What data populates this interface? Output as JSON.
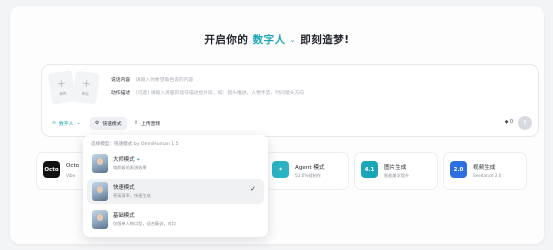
{
  "headline": {
    "prefix": "开启你的",
    "accent": "数字人",
    "chevron": "⌄",
    "suffix": "即刻造梦!"
  },
  "composer": {
    "upload_1": "角色",
    "upload_2": "音色",
    "dialogue_label": "说话内容",
    "dialogue_placeholder": "请输入你希望角色说的内容",
    "action_label": "动作描述",
    "action_placeholder": "(可选) 请输入清楚的动作描述给片段，如：镜头推进，人物手势，时间镜头方向",
    "digital_human": "数字人",
    "mode_chip": "快速模式",
    "audio_upload": "上传音频",
    "credits": "0"
  },
  "dropdown": {
    "header": "选择模型：快速模式 by OmniHuman 1.5",
    "modes": [
      {
        "title": "大师模式",
        "desc": "电影级的表演效果",
        "badge": "✦",
        "selected": false
      },
      {
        "title": "快速模式",
        "desc": "更高清率，快速生成",
        "selected": true
      },
      {
        "title": "基础模式",
        "desc": "仅限单人物口型，适合集训，对口",
        "selected": false
      }
    ]
  },
  "cards": [
    {
      "icon": "Octo",
      "title": "Octo",
      "sub": "Vibe",
      "color": "#111111"
    },
    {
      "icon": "✦",
      "title": "Agent 模式",
      "sub": "52.0%帧制作",
      "color": "#2bb3c4"
    },
    {
      "icon": "4.1",
      "title": "图片生成",
      "sub": "智能美学提升",
      "color": "#1aa6b7"
    },
    {
      "icon": "2.0",
      "title": "视频生成",
      "sub": "Seedance 2.0",
      "color": "#2d6fe0"
    }
  ]
}
